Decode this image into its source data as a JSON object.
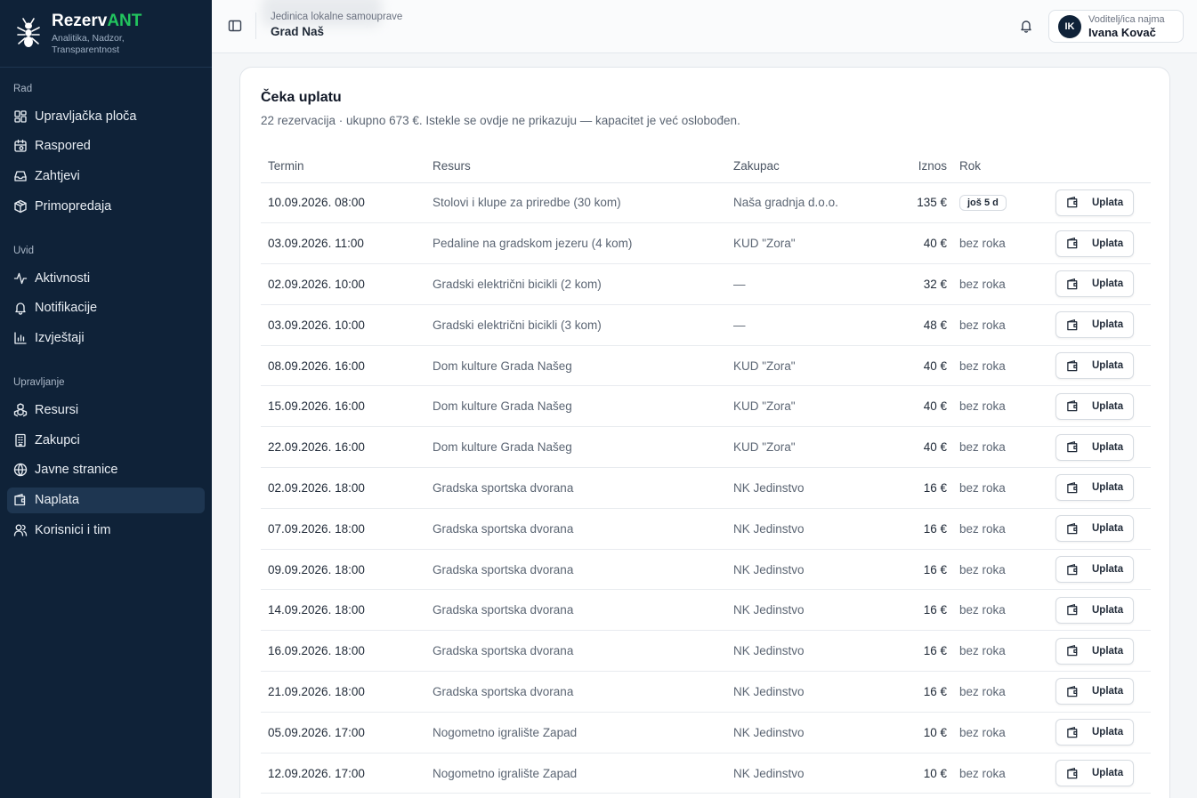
{
  "brand": {
    "name_main": "Rezerv",
    "name_accent": "ANT",
    "tagline_1": "Analitika, Nadzor,",
    "tagline_2": "Transparentnost",
    "accent_color": "#22c55e"
  },
  "sidebar": {
    "sections": [
      {
        "title": "Rad",
        "items": [
          {
            "label": "Upravljačka ploča",
            "icon": "dashboard-icon"
          },
          {
            "label": "Raspored",
            "icon": "calendar-icon"
          },
          {
            "label": "Zahtjevi",
            "icon": "inbox-icon"
          },
          {
            "label": "Primopredaja",
            "icon": "package-icon"
          }
        ]
      },
      {
        "title": "Uvid",
        "items": [
          {
            "label": "Aktivnosti",
            "icon": "activity-icon"
          },
          {
            "label": "Notifikacije",
            "icon": "bell-icon"
          },
          {
            "label": "Izvještaji",
            "icon": "bar-chart-icon"
          }
        ]
      },
      {
        "title": "Upravljanje",
        "items": [
          {
            "label": "Resursi",
            "icon": "boxes-icon"
          },
          {
            "label": "Zakupci",
            "icon": "building-icon"
          },
          {
            "label": "Javne stranice",
            "icon": "globe-icon"
          },
          {
            "label": "Naplata",
            "icon": "wallet-icon",
            "active": true
          },
          {
            "label": "Korisnici i tim",
            "icon": "users-icon"
          }
        ]
      }
    ]
  },
  "header": {
    "org_label": "Jedinica lokalne samouprave",
    "org_name": "Grad Naš",
    "user_initials": "IK",
    "user_role": "Voditelj/ica najma",
    "user_name": "Ivana Kovač"
  },
  "card": {
    "title": "Čeka uplatu",
    "subtitle": "22 rezervacija · ukupno 673 €. Istekle se ovdje ne prikazuju — kapacitet je već oslobođen.",
    "columns": [
      "Termin",
      "Resurs",
      "Zakupac",
      "Iznos",
      "Rok"
    ],
    "pay_label": "Uplata",
    "rows": [
      {
        "termin": "10.09.2026. 08:00",
        "resurs": "Stolovi i klupe za priredbe (30 kom)",
        "zakupac": "Naša gradnja d.o.o.",
        "iznos": "135 €",
        "rok": "još 5 d",
        "badge": true
      },
      {
        "termin": "03.09.2026. 11:00",
        "resurs": "Pedaline na gradskom jezeru (4 kom)",
        "zakupac": "KUD \"Zora\"",
        "iznos": "40 €",
        "rok": "bez roka"
      },
      {
        "termin": "02.09.2026. 10:00",
        "resurs": "Gradski električni bicikli (2 kom)",
        "zakupac": "—",
        "iznos": "32 €",
        "rok": "bez roka"
      },
      {
        "termin": "03.09.2026. 10:00",
        "resurs": "Gradski električni bicikli (3 kom)",
        "zakupac": "—",
        "iznos": "48 €",
        "rok": "bez roka"
      },
      {
        "termin": "08.09.2026. 16:00",
        "resurs": "Dom kulture Grada Našeg",
        "zakupac": "KUD \"Zora\"",
        "iznos": "40 €",
        "rok": "bez roka"
      },
      {
        "termin": "15.09.2026. 16:00",
        "resurs": "Dom kulture Grada Našeg",
        "zakupac": "KUD \"Zora\"",
        "iznos": "40 €",
        "rok": "bez roka"
      },
      {
        "termin": "22.09.2026. 16:00",
        "resurs": "Dom kulture Grada Našeg",
        "zakupac": "KUD \"Zora\"",
        "iznos": "40 €",
        "rok": "bez roka"
      },
      {
        "termin": "02.09.2026. 18:00",
        "resurs": "Gradska sportska dvorana",
        "zakupac": "NK Jedinstvo",
        "iznos": "16 €",
        "rok": "bez roka"
      },
      {
        "termin": "07.09.2026. 18:00",
        "resurs": "Gradska sportska dvorana",
        "zakupac": "NK Jedinstvo",
        "iznos": "16 €",
        "rok": "bez roka"
      },
      {
        "termin": "09.09.2026. 18:00",
        "resurs": "Gradska sportska dvorana",
        "zakupac": "NK Jedinstvo",
        "iznos": "16 €",
        "rok": "bez roka"
      },
      {
        "termin": "14.09.2026. 18:00",
        "resurs": "Gradska sportska dvorana",
        "zakupac": "NK Jedinstvo",
        "iznos": "16 €",
        "rok": "bez roka"
      },
      {
        "termin": "16.09.2026. 18:00",
        "resurs": "Gradska sportska dvorana",
        "zakupac": "NK Jedinstvo",
        "iznos": "16 €",
        "rok": "bez roka"
      },
      {
        "termin": "21.09.2026. 18:00",
        "resurs": "Gradska sportska dvorana",
        "zakupac": "NK Jedinstvo",
        "iznos": "16 €",
        "rok": "bez roka"
      },
      {
        "termin": "05.09.2026. 17:00",
        "resurs": "Nogometno igralište Zapad",
        "zakupac": "NK Jedinstvo",
        "iznos": "10 €",
        "rok": "bez roka"
      },
      {
        "termin": "12.09.2026. 17:00",
        "resurs": "Nogometno igralište Zapad",
        "zakupac": "NK Jedinstvo",
        "iznos": "10 €",
        "rok": "bez roka"
      }
    ]
  }
}
